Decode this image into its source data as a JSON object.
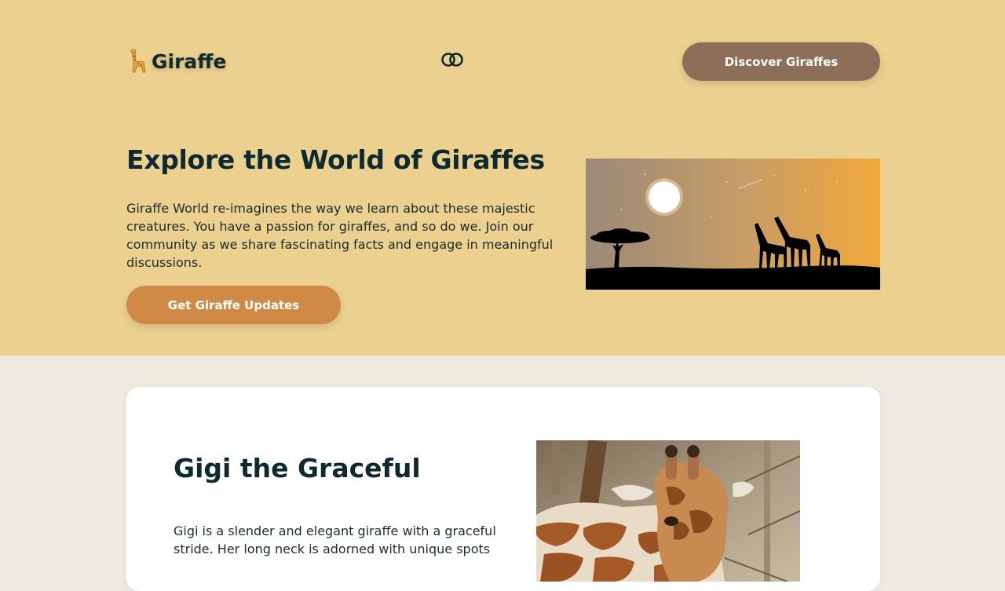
{
  "brand": {
    "name": "Giraffe",
    "logo_icon": "giraffe-icon"
  },
  "header": {
    "theme_toggle_icon": "toggle-icon",
    "nav_button_label": "Discover Giraffes"
  },
  "hero": {
    "title": "Explore the World of Giraffes",
    "description": "Giraffe World re-imagines the way we learn about these majestic creatures. You have a passion for giraffes, and so do we. Join our community as we share fascinating facts and engage in meaningful discussions.",
    "cta_label": "Get Giraffe Updates",
    "illustration": "savanna-sunset-giraffes-illustration"
  },
  "feature": {
    "title": "Gigi the Graceful",
    "description": "Gigi is a slender and elegant giraffe with a graceful stride. Her long neck is adorned with unique spots",
    "photo": "giraffe-photo"
  },
  "colors": {
    "hero_bg": "#ecd08f",
    "page_bg": "#f0ebe0",
    "nav_button": "#8d6e58",
    "cta_button": "#d08a45",
    "text": "#0e2a30"
  }
}
